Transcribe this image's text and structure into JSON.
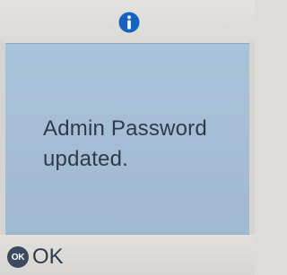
{
  "header": {
    "icon": "info-icon",
    "icon_color": "#1565c0"
  },
  "message": {
    "line1": "Admin Password",
    "line2": "updated."
  },
  "softkeys": {
    "ok_icon_label": "OK",
    "ok_label": "OK"
  },
  "colors": {
    "panel": "#a6bfd6",
    "background": "#dedcd8",
    "text": "#2f3b4a"
  }
}
